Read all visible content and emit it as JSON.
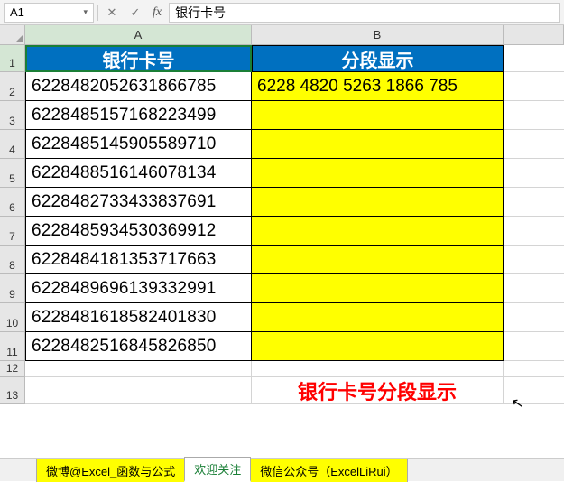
{
  "name_box": "A1",
  "formula_bar": "银行卡号",
  "columns": [
    "A",
    "B"
  ],
  "headers": {
    "A": "银行卡号",
    "B": "分段显示"
  },
  "rows": [
    {
      "n": 1
    },
    {
      "n": 2,
      "A": "6228482052631866785",
      "B": "6228 4820 5263 1866 785"
    },
    {
      "n": 3,
      "A": "6228485157168223499",
      "B": ""
    },
    {
      "n": 4,
      "A": "6228485145905589710",
      "B": ""
    },
    {
      "n": 5,
      "A": "6228488516146078134",
      "B": ""
    },
    {
      "n": 6,
      "A": "6228482733433837691",
      "B": ""
    },
    {
      "n": 7,
      "A": "6228485934530369912",
      "B": ""
    },
    {
      "n": 8,
      "A": "6228484181353717663",
      "B": ""
    },
    {
      "n": 9,
      "A": "6228489696139332991",
      "B": ""
    },
    {
      "n": 10,
      "A": "6228481618582401830",
      "B": ""
    },
    {
      "n": 11,
      "A": "6228482516845826850",
      "B": ""
    },
    {
      "n": 12
    },
    {
      "n": 13
    }
  ],
  "caption": "银行卡号分段显示",
  "tabs": [
    {
      "label": "微博@Excel_函数与公式",
      "active": false
    },
    {
      "label": "欢迎关注",
      "active": true
    },
    {
      "label": "微信公众号（ExcelLiRui）",
      "active": false
    }
  ],
  "fbar_icons": {
    "cancel": "✕",
    "confirm": "✓",
    "fx": "fx",
    "dd": "▾"
  }
}
